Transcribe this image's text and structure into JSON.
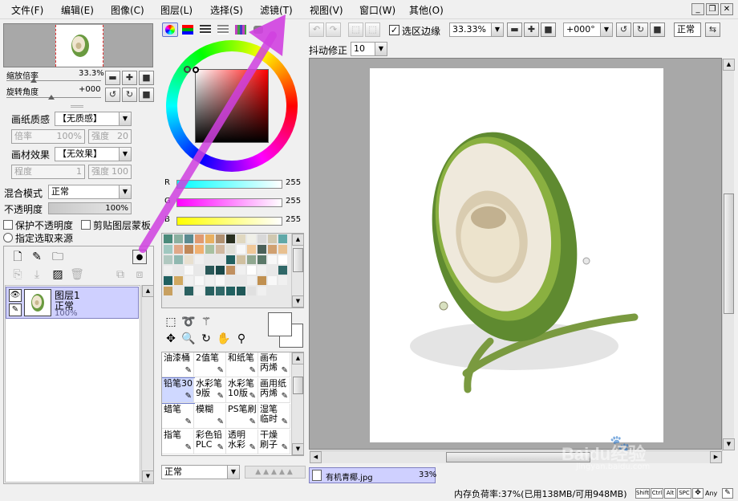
{
  "menu": [
    "文件(F)",
    "编辑(E)",
    "图像(C)",
    "图层(L)",
    "选择(S)",
    "滤镜(T)",
    "视图(V)",
    "窗口(W)",
    "其他(O)"
  ],
  "window_buttons": [
    "minimize-icon",
    "restore-icon",
    "close-icon"
  ],
  "navigator": {
    "zoom_label": "缩放倍率",
    "zoom_value": "33.3%",
    "rotate_label": "旋转角度",
    "rotate_value": "+000"
  },
  "paper_texture": {
    "label": "画纸质感",
    "value": "【无质感】",
    "scale_label": "倍率",
    "scale_value": "100%",
    "strength_label": "强度",
    "strength_value": "20"
  },
  "paper_effect": {
    "label": "画材效果",
    "value": "【无效果】",
    "degree_label": "程度",
    "degree_value": "1",
    "strength_label": "强度",
    "strength_value": "100"
  },
  "blend": {
    "label": "混合模式",
    "value": "正常"
  },
  "opacity": {
    "label": "不透明度",
    "value": "100%"
  },
  "checks": {
    "preserve_opacity": "保护不透明度",
    "clip_mask": "剪贴图层蒙板",
    "source": "指定选取来源"
  },
  "layer": {
    "name": "图层1",
    "mode": "正常",
    "opacity": "100%"
  },
  "color": {
    "r_label": "R",
    "r_value": "255",
    "g_label": "G",
    "g_value": "255",
    "b_label": "B",
    "b_value": "255"
  },
  "swatches": [
    "#4a8a7a",
    "#8ab0a0",
    "#5a8a90",
    "#e09a70",
    "#e8b060",
    "#b09070",
    "#2a3020",
    "#e0d8c0",
    "#f0f0e8",
    "#d8d8d8",
    "#d0c8b0",
    "#60a8a8",
    "#a0c8c0",
    "#e0a888",
    "#c08858",
    "#f0b070",
    "#a8c0a0",
    "#d0b8a0",
    "#e0e0d8",
    "#f8f8f8",
    "#f0c898",
    "#4a6058",
    "#d0a070",
    "#e8c090",
    "#b0c8c0",
    "#90b8b0",
    "#e8e0d0",
    "#f0f0f0",
    "#e8e8e8",
    "#e8e8e8",
    "#206060",
    "#d0c0a0",
    "#90a890",
    "#5a7868",
    "#f8f8f8",
    "#ffffff",
    "#f0f0f0",
    "#e8e8e8",
    "#f8f8f8",
    "#e8e8e8",
    "#2a5858",
    "#1a4848",
    "#c09060",
    "#f0f0f0",
    "#ffffff",
    "#f0f0f0",
    "#e8e8e8",
    "#306868",
    "#206060",
    "#d0a860",
    "#f0f0f0",
    "#f8f8f8",
    "#f0f0f0",
    "#f8f8f8",
    "#e8e8e8",
    "#e8e8e8",
    "#f0f0f0",
    "#c09050",
    "#f8f8f8",
    "#f0f0f0",
    "#c8a060",
    "#e8e8e8",
    "#2a6060",
    "#f0f0f0",
    "#286060",
    "#306868",
    "#206060",
    "#205858",
    "#e0e0e0",
    "#f0f0f0"
  ],
  "brushes": [
    {
      "label": "油漆桶",
      "icon": "bucket-icon"
    },
    {
      "label": "2值笔",
      "icon": "pen-icon"
    },
    {
      "label": "和纸笔",
      "icon": "brush-icon"
    },
    {
      "label": "画布\n丙烯",
      "icon": "brush-icon"
    },
    {
      "label": "铅笔30",
      "icon": "pencil-icon"
    },
    {
      "label": "水彩笔\n9版",
      "icon": "watercolor-icon"
    },
    {
      "label": "水彩笔\n10版",
      "icon": "watercolor-icon"
    },
    {
      "label": "画用纸\n丙烯",
      "icon": "brush-icon"
    },
    {
      "label": "蜡笔",
      "icon": "crayon-icon"
    },
    {
      "label": "模糊",
      "icon": "blur-icon"
    },
    {
      "label": "PS笔刷",
      "icon": "brush-icon"
    },
    {
      "label": "湿笔\n临时",
      "icon": "brush-icon"
    },
    {
      "label": "指笔",
      "icon": "finger-icon"
    },
    {
      "label": "彩色铅\nPLC",
      "icon": "pencil-icon"
    },
    {
      "label": "透明\n水彩",
      "icon": "brush-icon"
    },
    {
      "label": "干燥\n刷子",
      "icon": "brush-icon"
    }
  ],
  "brush_mode": "正常",
  "toolbar": {
    "selection_edge": "选区边缘",
    "zoom": "33.33%",
    "rotation": "+000°",
    "view_mode": "正常",
    "stabilizer_label": "抖动修正",
    "stabilizer_value": "10"
  },
  "document_tab": {
    "name": "有机青椰.jpg",
    "zoom": "33%"
  },
  "status": {
    "memory": "内存负荷率:37%(已用138MB/可用948MB)",
    "keys": [
      "Shift",
      "Ctrl",
      "Alt",
      "SPC"
    ],
    "any": "Any"
  },
  "watermark": {
    "text": "Baidu经验",
    "url": "jingyan.baidu.com"
  },
  "colors": {
    "accent": "#d040e0",
    "selection": "#cfd8ff",
    "panel_border": "#a8a8a8"
  }
}
